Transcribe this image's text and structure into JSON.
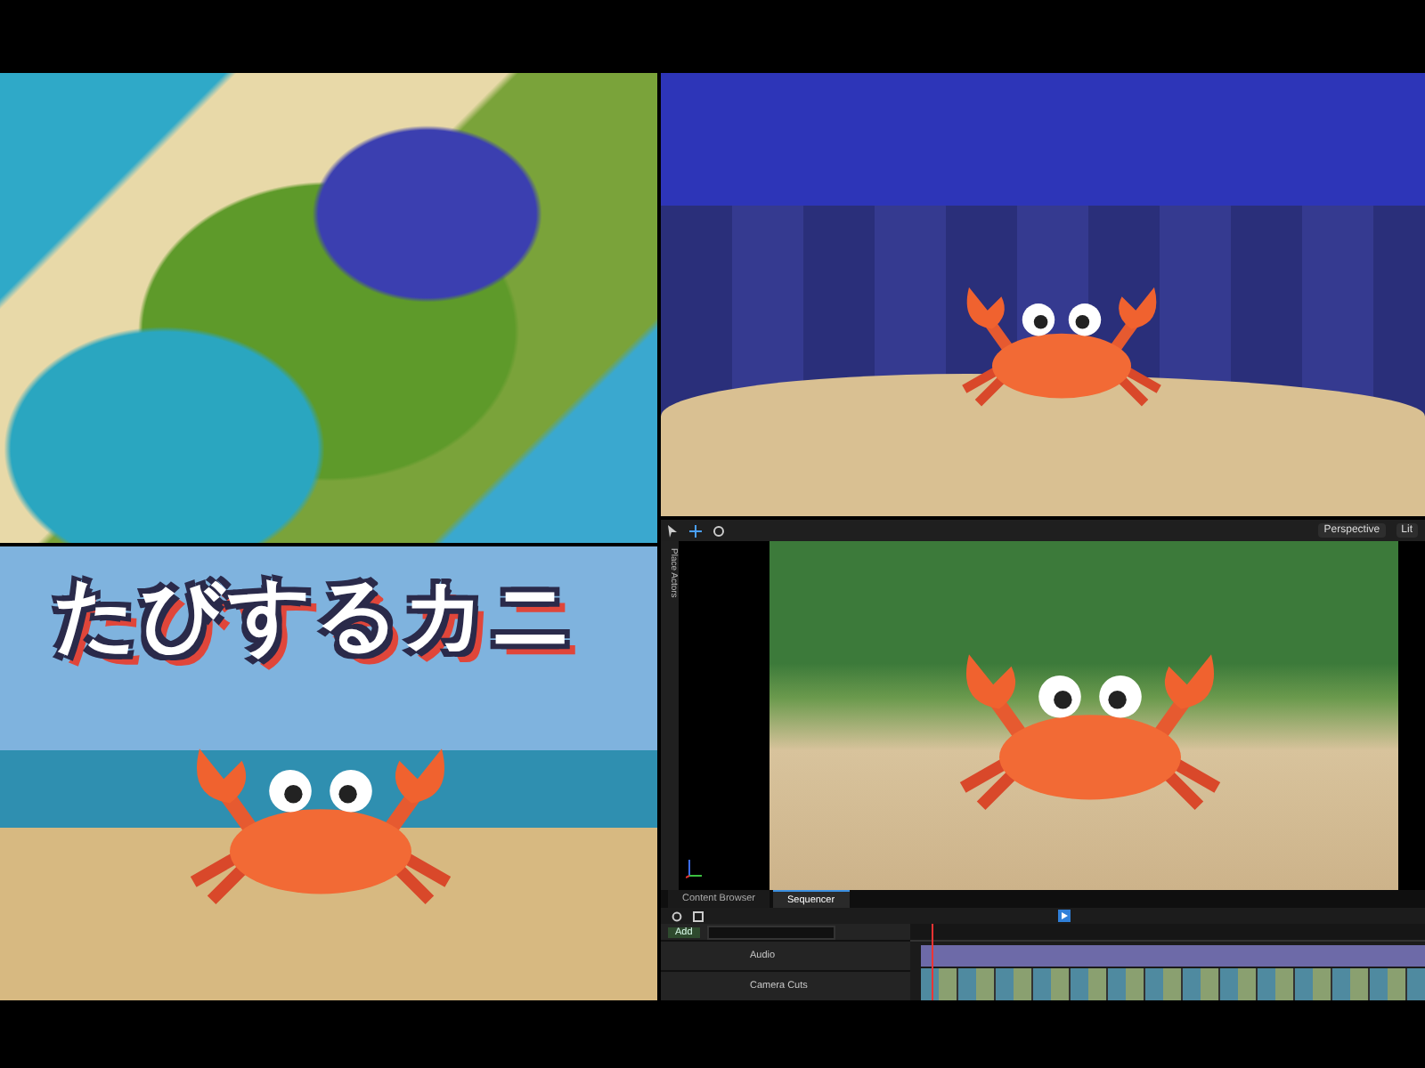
{
  "title_card": {
    "title": "たびするカニ"
  },
  "editor": {
    "side_tab": "Place Actors",
    "view_mode": "Perspective",
    "lighting": "Lit",
    "tabs": [
      {
        "label": "Content Browser",
        "selected": false
      },
      {
        "label": "Sequencer",
        "selected": true
      }
    ],
    "add_button": "Add",
    "tracks": [
      {
        "name": "Audio",
        "kind": "audio"
      },
      {
        "name": "Camera Cuts",
        "kind": "camera"
      }
    ]
  }
}
